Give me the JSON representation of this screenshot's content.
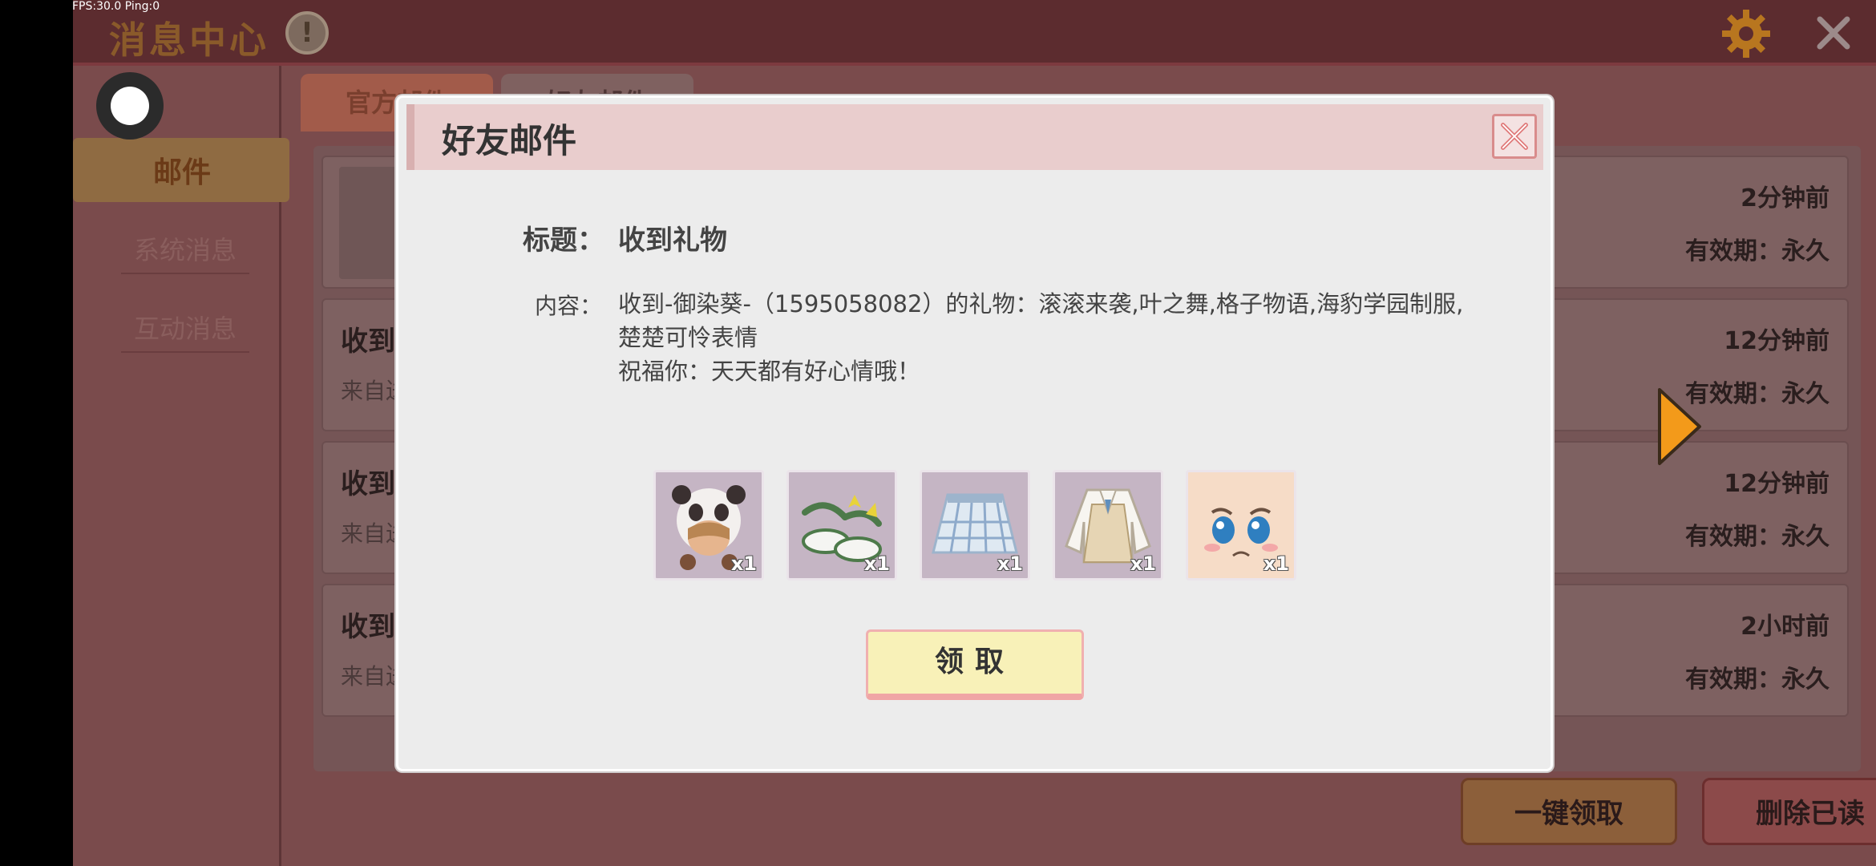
{
  "status_bar": {
    "fps": "FPS:30.0 Ping:0"
  },
  "topbar": {
    "title": "消息中心",
    "info_icon": "info-icon",
    "settings_icon": "gear-icon",
    "close_icon": "close-icon",
    "info_glyph": "!"
  },
  "sidebar": {
    "active": "邮件",
    "items": [
      "系统消息",
      "互动消息"
    ]
  },
  "tabs": [
    "官方邮件",
    "好友邮件"
  ],
  "mail_list": [
    {
      "title": "",
      "sub": "",
      "time": "2分钟前",
      "expiry": "有效期：永久"
    },
    {
      "title": "收到",
      "sub": "来自送",
      "time": "12分钟前",
      "expiry": "有效期：永久"
    },
    {
      "title": "收到",
      "sub": "来自送",
      "time": "12分钟前",
      "expiry": "有效期：永久"
    },
    {
      "title": "收到",
      "sub": "来自送",
      "time": "2小时前",
      "expiry": "有效期：永久"
    }
  ],
  "bottom_buttons": {
    "claim_all": "一键领取",
    "delete_read": "删除已读"
  },
  "modal": {
    "title": "好友邮件",
    "subject_label": "标题：",
    "subject": "收到礼物",
    "content_label": "内容：",
    "content_line1": "收到-御染葵-（1595058082）的礼物：滚滚来袭,叶之舞,格子物语,海豹学园制服,楚楚可怜表情",
    "content_line2": "祝福你：天天都有好心情哦！",
    "items": [
      {
        "name": "panda-hat",
        "qty": "x1"
      },
      {
        "name": "leaf-shoes",
        "qty": "x1"
      },
      {
        "name": "plaid-skirt",
        "qty": "x1"
      },
      {
        "name": "school-uniform",
        "qty": "x1"
      },
      {
        "name": "pitiful-expression",
        "qty": "x1"
      }
    ],
    "claim_label": "领取"
  },
  "colors": {
    "accent_orange": "#f39a1a",
    "modal_header": "#e9cdcd",
    "claim_button": "#f8f1b8"
  }
}
